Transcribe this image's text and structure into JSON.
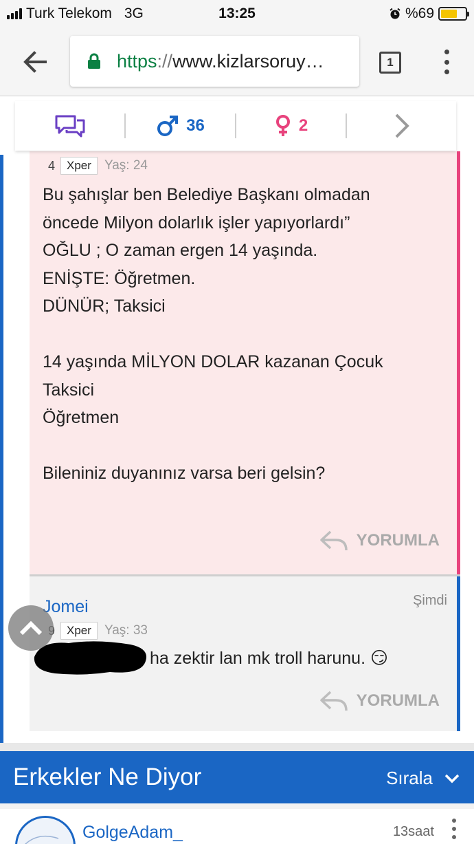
{
  "status_bar": {
    "carrier": "Turk Telekom",
    "network": "3G",
    "time": "13:25",
    "battery_text": "%69",
    "battery_level": 0.69,
    "battery_color": "#f5c400"
  },
  "browser": {
    "url_scheme": "https",
    "url_separator": "://",
    "url_host": "www.kizlarsoruy…",
    "tab_count": "1"
  },
  "stats_bar": {
    "male_count": "36",
    "female_count": "2"
  },
  "answer": {
    "xper_level": "4",
    "xper_label": "Xper",
    "age": "Yaş: 24",
    "text": "Bu şahışlar ben Belediye Başkanı olmadan\nöncede Milyon dolarlık işler yapıyorlardı”\nOĞLU ; O zaman ergen 14 yaşında.\nENİŞTE: Öğretmen.\nDÜNÜR; Taksici\n\n14 yaşında MİLYON DOLAR kazanan Çocuk\nTaksici\nÖğretmen\n\nBileniniz duyanınız varsa beri gelsin?",
    "reply_label": "YORUMLA"
  },
  "comment": {
    "username": "Jomei",
    "time": "Şimdi",
    "xper_level": "9",
    "xper_label": "Xper",
    "age": "Yaş: 33",
    "text": "ha zektir lan mk troll harunu. 😏",
    "reply_label": "YORUMLA"
  },
  "section": {
    "title": "Erkekler Ne Diyor",
    "sort_label": "Sırala"
  },
  "next_answer": {
    "username": "GolgeAdam_",
    "time": "13saat"
  },
  "colors": {
    "male_blue": "#1a66c4",
    "female_pink": "#e8437d",
    "answer_bg": "#fce9ea",
    "url_green": "#0b8043"
  }
}
